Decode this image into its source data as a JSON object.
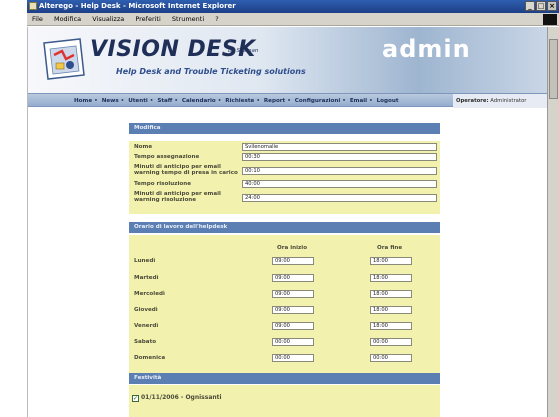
{
  "window": {
    "title": "Alterego - Help Desk - Microsoft Internet Explorer",
    "menu": [
      "File",
      "Modifica",
      "Visualizza",
      "Preferiti",
      "Strumenti",
      "?"
    ]
  },
  "header": {
    "brand": "VISION DESK",
    "brand_by": "by Sysman",
    "tagline": "Help Desk and Trouble Ticketing solutions",
    "area": "admin"
  },
  "nav": {
    "links": [
      "Home",
      "News",
      "Utenti",
      "Staff",
      "Calendario",
      "Richieste",
      "Report",
      "Configurazioni",
      "Email",
      "Logout"
    ],
    "separator": "•",
    "operator_label": "Operatore:",
    "operator_value": "Administrator"
  },
  "modifica": {
    "title": "Modifica",
    "fields": [
      {
        "label": "Nome",
        "value": "Svilenomalie"
      },
      {
        "label": "Tempo assegnazione",
        "value": "00:30"
      },
      {
        "label": "Minuti di anticipo per email warning tempo di presa in carico",
        "value": "00:10"
      },
      {
        "label": "Tempo risoluzione",
        "value": "40:00"
      },
      {
        "label": "Minuti di anticipo per email warning risoluzione",
        "value": "24:00"
      }
    ]
  },
  "orario": {
    "title": "Orario di lavoro dell'helpdesk",
    "col_start": "Ora inizio",
    "col_end": "Ora fine",
    "days": [
      {
        "day": "Lunedì",
        "start": "09:00",
        "end": "18:00"
      },
      {
        "day": "Martedì",
        "start": "09:00",
        "end": "18:00"
      },
      {
        "day": "Mercoledì",
        "start": "09:00",
        "end": "18:00"
      },
      {
        "day": "Giovedì",
        "start": "09:00",
        "end": "18:00"
      },
      {
        "day": "Venerdì",
        "start": "09:00",
        "end": "18:00"
      },
      {
        "day": "Sabato",
        "start": "00:00",
        "end": "00:00"
      },
      {
        "day": "Domenica",
        "start": "00:00",
        "end": "00:00"
      }
    ]
  },
  "festivita": {
    "title": "Festività",
    "items": [
      {
        "checked": true,
        "label": "01/11/2006 - Ognissanti"
      }
    ]
  }
}
